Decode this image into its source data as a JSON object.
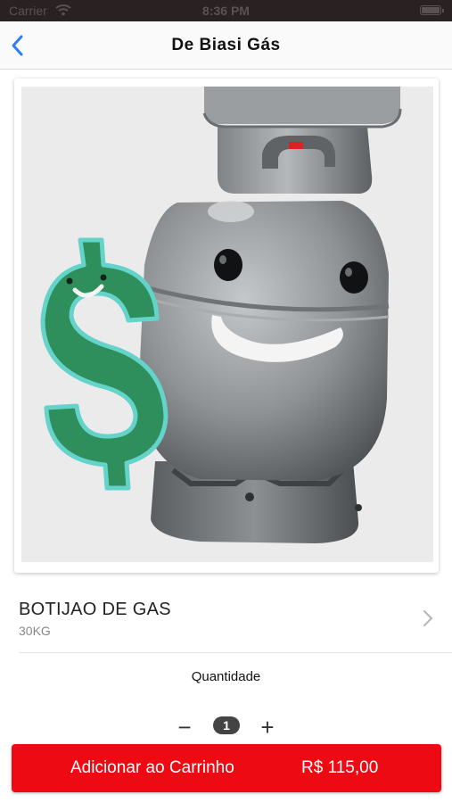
{
  "status_bar": {
    "carrier": "Carrier",
    "time": "8:36 PM"
  },
  "nav": {
    "back_icon": "chevron-left-icon",
    "title": "De Biasi Gás"
  },
  "product": {
    "image_icon": "gas-cylinder-mascot",
    "name": "BOTIJAO DE GAS",
    "variant": "30KG",
    "detail_icon": "chevron-right-icon"
  },
  "quantity": {
    "label": "Quantidade",
    "minus": "−",
    "value": "1",
    "plus": "+"
  },
  "cart_button": {
    "label": "Adicionar ao Carrinho",
    "price": "R$ 115,00"
  },
  "colors": {
    "accent": "#ee0a12",
    "nav_tint": "#2f7df6",
    "status_bar": "#2a2222"
  }
}
